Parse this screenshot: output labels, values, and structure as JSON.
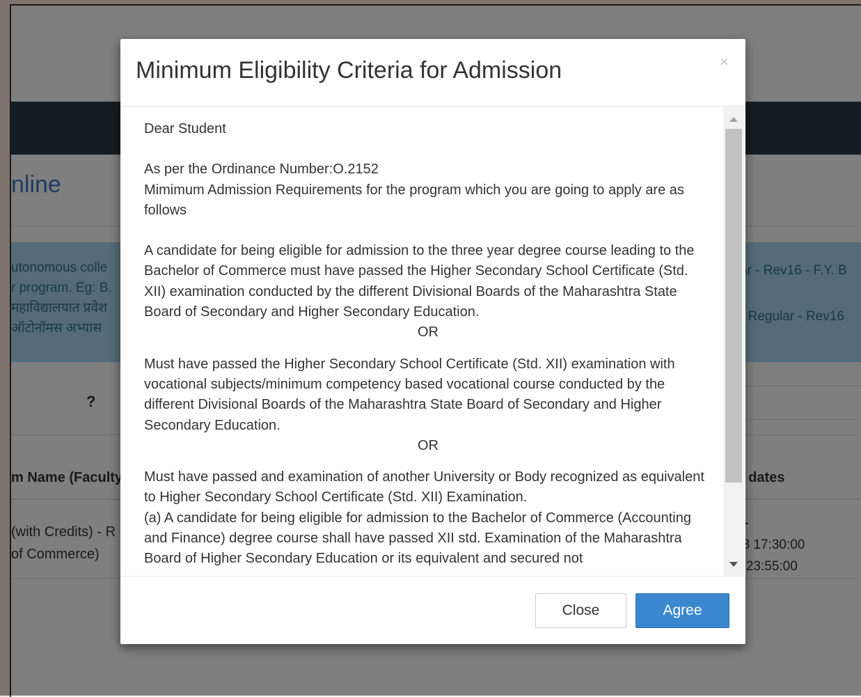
{
  "background": {
    "heading": "nline",
    "alert_left_lines": [
      "utonomous colle",
      "r program. Eg: B.",
      "महाविद्यालयात प्रवेश",
      " ऑटोनॉमस अभ्यास"
    ],
    "alert_right_lines": [
      "ar - Rev16 - F.Y. B",
      "",
      "- Regular - Rev16"
    ],
    "question_mark": "?",
    "column_left": "m Name (Faculty",
    "column_right": "t dates",
    "cell_left_lines": [
      "(with Credits) - R",
      " of Commerce)"
    ],
    "cell_right_lines": [
      "---",
      "23 17:30:00",
      "3 23:55:00"
    ]
  },
  "modal": {
    "title": "Minimum Eligibility Criteria for Admission",
    "close_symbol": "×",
    "body": {
      "greeting": "Dear Student",
      "ordinance": "As per the Ordinance Number:O.2152",
      "intro": "Mimimum Admission Requirements for the program which you are going to apply are as follows",
      "para1": "A candidate for being eligible for admission to the three year degree course leading to the Bachelor of Commerce must have passed the Higher Secondary School Certificate (Std. XII) examination conducted by the different Divisional Boards of the Maharashtra State Board of Secondary and Higher Secondary Education.",
      "or1": "OR",
      "para2": "Must have passed the Higher Secondary School Certificate (Std. XII) examination with vocational subjects/minimum competency based vocational course conducted by the different Divisional Boards of the Maharashtra State Board of Secondary and Higher Secondary Education.",
      "or2": "OR",
      "para3": "Must have passed and examination of another University or Body recognized as equivalent to Higher Secondary School Certificate (Std. XII) Examination.",
      "para4": "(a) A candidate for being eligible for admission to the Bachelor of Commerce (Accounting and Finance) degree course shall have passed XII std. Examination of the Maharashtra Board of Higher Secondary Education or its equivalent and secured not"
    },
    "footer": {
      "close_label": "Close",
      "agree_label": "Agree"
    }
  },
  "colors": {
    "agree_button": "#3b87cf",
    "page_border_bg": "#fde6da",
    "nav_bar": "#2b3a4a",
    "alert_bg": "#a9d9ee"
  }
}
